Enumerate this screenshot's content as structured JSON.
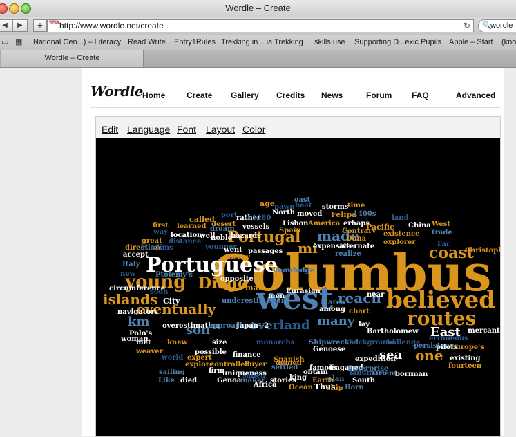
{
  "window": {
    "title": "Wordle – Create"
  },
  "toolbar": {
    "url": "http://www.wordle.net/create",
    "search_value": "wordle",
    "favicon_text": "WRDL"
  },
  "bookmarks": [
    "National Cen...) – Literacy",
    "Read Write ...Entry1Rules",
    "Trekking in ...ia Trekking",
    "skills use",
    "Supporting D...exic Pupils",
    "Apple – Start",
    "(kno"
  ],
  "tab": {
    "label": "Wordle – Create"
  },
  "site": {
    "logo": "Wordle",
    "nav": [
      "Home",
      "Create",
      "Gallery",
      "Credits",
      "News",
      "Forum",
      "FAQ",
      "Advanced"
    ]
  },
  "editor": {
    "menu": [
      "Edit",
      "Language",
      "Font",
      "Layout",
      "Color"
    ]
  },
  "colors": {
    "orange": "#d9951e",
    "blue": "#4f82b2",
    "white": "#ffffff",
    "dark_blue": "#2d5d90",
    "canvas": "#000000"
  },
  "cloud": [
    {
      "t": "Columbus",
      "c": "orange"
    },
    {
      "t": "west",
      "c": "blue"
    },
    {
      "t": "Portuguese",
      "c": "white"
    },
    {
      "t": "believed",
      "c": "orange"
    },
    {
      "t": "young",
      "c": "orange"
    },
    {
      "t": "routes",
      "c": "orange"
    },
    {
      "t": "Portugal",
      "c": "orange"
    },
    {
      "t": "eventually",
      "c": "orange"
    },
    {
      "t": "made",
      "c": "blue"
    },
    {
      "t": "mi",
      "c": "orange"
    },
    {
      "t": "reach",
      "c": "blue"
    },
    {
      "t": "islands",
      "c": "orange"
    },
    {
      "t": "Diego",
      "c": "orange"
    },
    {
      "t": "son",
      "c": "blue"
    },
    {
      "t": "overland",
      "c": "dark_blue"
    },
    {
      "t": "coast",
      "c": "orange"
    },
    {
      "t": "many",
      "c": "blue"
    },
    {
      "t": "km",
      "c": "blue"
    },
    {
      "t": "East",
      "c": "white"
    },
    {
      "t": "one",
      "c": "orange"
    },
    {
      "t": "sea",
      "c": "white"
    },
    {
      "t": "age",
      "c": "orange"
    },
    {
      "t": "east",
      "c": "blue"
    },
    {
      "t": "time",
      "c": "orange"
    },
    {
      "t": "storms",
      "c": "white"
    },
    {
      "t": "port",
      "c": "dark_blue"
    },
    {
      "t": "pawn",
      "c": "dark_blue"
    },
    {
      "t": "beat",
      "c": "dark_blue"
    },
    {
      "t": "North",
      "c": "white"
    },
    {
      "t": "moved",
      "c": "white"
    },
    {
      "t": "Felipa",
      "c": "orange"
    },
    {
      "t": "called",
      "c": "orange"
    },
    {
      "t": "rather",
      "c": "white"
    },
    {
      "t": "c.1480",
      "c": "dark_blue"
    },
    {
      "t": "1400s",
      "c": "blue"
    },
    {
      "t": "land",
      "c": "dark_blue"
    },
    {
      "t": "desert",
      "c": "orange"
    },
    {
      "t": "Lisbon",
      "c": "white"
    },
    {
      "t": "America",
      "c": "orange"
    },
    {
      "t": "erhaps",
      "c": "white"
    },
    {
      "t": "Pacific",
      "c": "orange"
    },
    {
      "t": "China",
      "c": "white"
    },
    {
      "t": "West",
      "c": "orange"
    },
    {
      "t": "first",
      "c": "orange"
    },
    {
      "t": "learned",
      "c": "orange"
    },
    {
      "t": "dream",
      "c": "blue"
    },
    {
      "t": "vessels",
      "c": "white"
    },
    {
      "t": "Spain",
      "c": "orange"
    },
    {
      "t": "Contrary",
      "c": "orange"
    },
    {
      "t": "existence",
      "c": "orange"
    },
    {
      "t": "trade",
      "c": "blue"
    },
    {
      "t": "way",
      "c": "dark_blue"
    },
    {
      "t": "location",
      "c": "white"
    },
    {
      "t": "well",
      "c": "white"
    },
    {
      "t": "hazards",
      "c": "white"
    },
    {
      "t": "Dona",
      "c": "orange"
    },
    {
      "t": "explorer",
      "c": "orange"
    },
    {
      "t": "great",
      "c": "orange"
    },
    {
      "t": "distance",
      "c": "dark_blue"
    },
    {
      "t": "noble",
      "c": "white"
    },
    {
      "t": "expensive",
      "c": "white"
    },
    {
      "t": "alternate",
      "c": "white"
    },
    {
      "t": "Far",
      "c": "dark_blue"
    },
    {
      "t": "direction",
      "c": "orange"
    },
    {
      "t": "Muslims",
      "c": "dark_blue"
    },
    {
      "t": "younger",
      "c": "dark_blue"
    },
    {
      "t": "went",
      "c": "white"
    },
    {
      "t": "passages",
      "c": "white"
    },
    {
      "t": "realize",
      "c": "blue"
    },
    {
      "t": "Christopher",
      "c": "orange"
    },
    {
      "t": "accept",
      "c": "white"
    },
    {
      "t": "Italy",
      "c": "blue"
    },
    {
      "t": "theory",
      "c": "orange"
    },
    {
      "t": "knowledge",
      "c": "blue"
    },
    {
      "t": "new",
      "c": "dark_blue"
    },
    {
      "t": "circumference",
      "c": "white"
    },
    {
      "t": "main",
      "c": "orange"
    },
    {
      "t": "opposite",
      "c": "white"
    },
    {
      "t": "Eurasian",
      "c": "white"
    },
    {
      "t": "soon",
      "c": "dark_blue"
    },
    {
      "t": "men",
      "c": "white"
    },
    {
      "t": "near",
      "c": "white"
    },
    {
      "t": "City",
      "c": "white"
    },
    {
      "t": "underestimation",
      "c": "blue"
    },
    {
      "t": "Marco",
      "c": "blue"
    },
    {
      "t": "among",
      "c": "white"
    },
    {
      "t": "navigators",
      "c": "white"
    },
    {
      "t": "chart",
      "c": "orange"
    },
    {
      "t": "overestimation",
      "c": "white"
    },
    {
      "t": "approached",
      "c": "blue"
    },
    {
      "t": "Japan--2",
      "c": "white"
    },
    {
      "t": "lay",
      "c": "white"
    },
    {
      "t": "mercantile",
      "c": "white"
    },
    {
      "t": "Polo's",
      "c": "white"
    },
    {
      "t": "Bartholomew",
      "c": "white"
    },
    {
      "t": "woman",
      "c": "white"
    },
    {
      "t": "size",
      "c": "white"
    },
    {
      "t": "monarchs",
      "c": "dark_blue"
    },
    {
      "t": "Shipwrecked",
      "c": "blue"
    },
    {
      "t": "background",
      "c": "dark_blue"
    },
    {
      "t": "challenge",
      "c": "dark_blue"
    },
    {
      "t": "met",
      "c": "white"
    },
    {
      "t": "knew",
      "c": "orange"
    },
    {
      "t": "possible",
      "c": "white"
    },
    {
      "t": "Genoese",
      "c": "white"
    },
    {
      "t": "persistence",
      "c": "blue"
    },
    {
      "t": "pilots",
      "c": "white"
    },
    {
      "t": "Europe's",
      "c": "orange"
    },
    {
      "t": "weaver",
      "c": "orange"
    },
    {
      "t": "world",
      "c": "dark_blue"
    },
    {
      "t": "expert",
      "c": "orange"
    },
    {
      "t": "finance",
      "c": "white"
    },
    {
      "t": "buyer",
      "c": "orange"
    },
    {
      "t": "Spanish",
      "c": "orange"
    },
    {
      "t": "expedition",
      "c": "white"
    },
    {
      "t": "existing",
      "c": "white"
    },
    {
      "t": "explore",
      "c": "orange"
    },
    {
      "t": "controlled",
      "c": "orange"
    },
    {
      "t": "sailed",
      "c": "dark_blue"
    },
    {
      "t": "settled",
      "c": "blue"
    },
    {
      "t": "denied",
      "c": "orange"
    },
    {
      "t": "famous",
      "c": "white"
    },
    {
      "t": "Engaged",
      "c": "white"
    },
    {
      "t": "Enterprise",
      "c": "blue"
    },
    {
      "t": "fourteen",
      "c": "orange"
    },
    {
      "t": "sailing",
      "c": "blue"
    },
    {
      "t": "firm",
      "c": "white"
    },
    {
      "t": "uniqueness",
      "c": "white"
    },
    {
      "t": "obtain",
      "c": "white"
    },
    {
      "t": "landmass",
      "c": "dark_blue"
    },
    {
      "t": "Orient",
      "c": "blue"
    },
    {
      "t": "born",
      "c": "white"
    },
    {
      "t": "man",
      "c": "white"
    },
    {
      "t": "Like",
      "c": "blue"
    },
    {
      "t": "died",
      "c": "white"
    },
    {
      "t": "Genoa",
      "c": "white"
    },
    {
      "t": "maker",
      "c": "blue"
    },
    {
      "t": "Africa",
      "c": "white"
    },
    {
      "t": "stories",
      "c": "white"
    },
    {
      "t": "king",
      "c": "white"
    },
    {
      "t": "Earth",
      "c": "orange"
    },
    {
      "t": "plan",
      "c": "blue"
    },
    {
      "t": "South",
      "c": "white"
    },
    {
      "t": "Ocean",
      "c": "orange"
    },
    {
      "t": "ship",
      "c": "orange"
    },
    {
      "t": "Born",
      "c": "blue"
    },
    {
      "t": "Thus",
      "c": "white"
    },
    {
      "t": "erroneous",
      "c": "dark_blue"
    },
    {
      "t": "Ptolemy's",
      "c": "blue"
    }
  ]
}
